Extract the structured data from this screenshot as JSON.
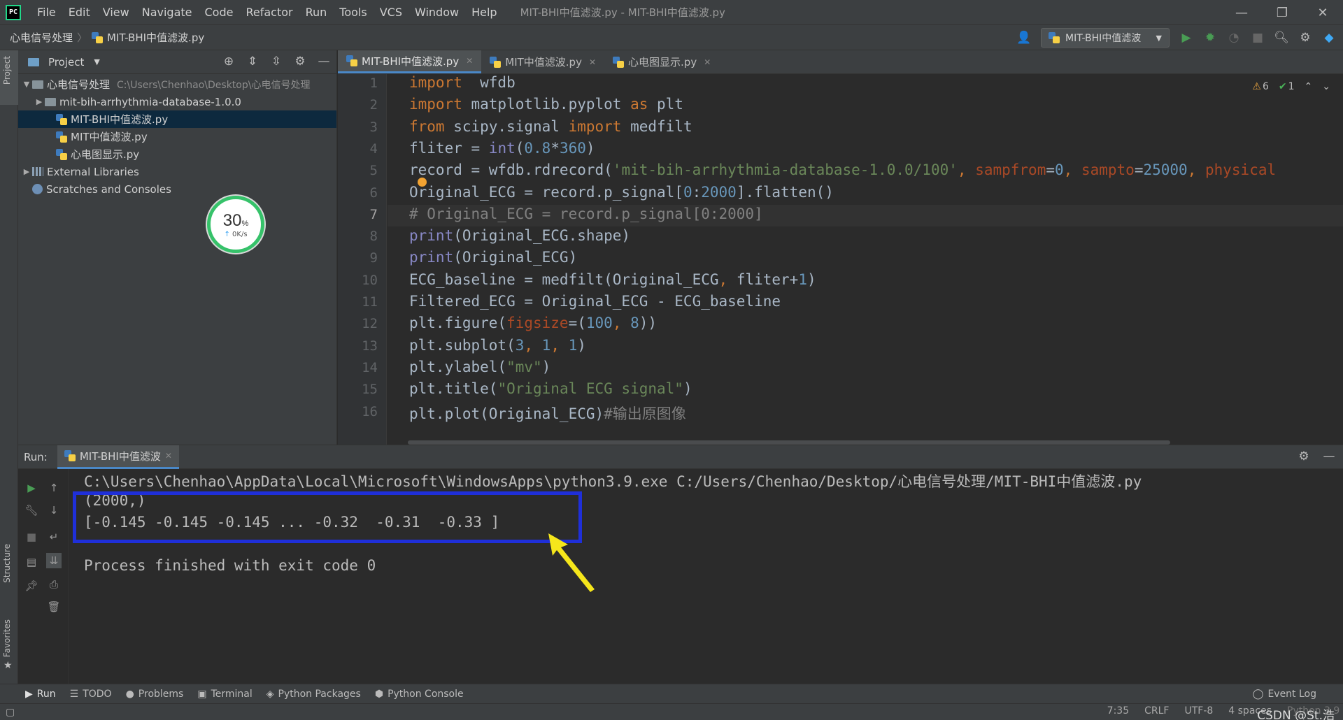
{
  "menu": {
    "items": [
      "File",
      "Edit",
      "View",
      "Navigate",
      "Code",
      "Refactor",
      "Run",
      "Tools",
      "VCS",
      "Window",
      "Help"
    ],
    "window_title": "MIT-BHI中值滤波.py - MIT-BHI中值滤波.py",
    "logo_text": "PC",
    "minimize": "—",
    "restore": "❐",
    "close": "✕"
  },
  "navbar": {
    "project": "心电信号处理",
    "separator": "〉",
    "file": "MIT-BHI中值滤波.py",
    "run_config": "MIT-BHI中值滤波"
  },
  "left_strip": {
    "project": "Project",
    "structure": "Structure",
    "favorites": "Favorites"
  },
  "project_panel": {
    "title": "Project",
    "tree": {
      "root": "心电信号处理",
      "root_path": "C:\\Users\\Chenhao\\Desktop\\心电信号处理",
      "db_folder": "mit-bih-arrhythmia-database-1.0.0",
      "files": [
        "MIT-BHI中值滤波.py",
        "MIT中值滤波.py",
        "心电图显示.py"
      ],
      "external": "External Libraries",
      "scratches": "Scratches and Consoles"
    }
  },
  "speed_widget": {
    "percent": "30",
    "unit": "%",
    "rate": "0K/s"
  },
  "editor": {
    "tabs": [
      "MIT-BHI中值滤波.py",
      "MIT中值滤波.py",
      "心电图显示.py"
    ],
    "active_tab": 0,
    "current_line": 7,
    "inspections": {
      "warnings": "6",
      "weak": "1"
    },
    "line_numbers": [
      "1",
      "2",
      "3",
      "4",
      "5",
      "6",
      "7",
      "8",
      "9",
      "10",
      "11",
      "12",
      "13",
      "14",
      "15",
      "16"
    ],
    "code": [
      [
        [
          "kw",
          "import"
        ],
        [
          "",
          "  wfdb"
        ]
      ],
      [
        [
          "kw",
          "import"
        ],
        [
          "",
          " matplotlib.pyplot "
        ],
        [
          "kw",
          "as"
        ],
        [
          "",
          " plt"
        ]
      ],
      [
        [
          "kw",
          "from"
        ],
        [
          "",
          " scipy.signal "
        ],
        [
          "kw",
          "import"
        ],
        [
          "",
          " medfilt"
        ]
      ],
      [
        [
          "",
          "fliter = "
        ],
        [
          "bi",
          "int"
        ],
        [
          "",
          "("
        ],
        [
          "num",
          "0.8"
        ],
        [
          "",
          "*"
        ],
        [
          "num",
          "360"
        ],
        [
          "",
          ")"
        ]
      ],
      [
        [
          "",
          "record = wfdb.rdrecord("
        ],
        [
          "str",
          "'mit-bih-arrhythmia-database-1.0.0/100'"
        ],
        [
          "kw",
          ", "
        ],
        [
          "param",
          "sampfrom"
        ],
        [
          "",
          "="
        ],
        [
          "num",
          "0"
        ],
        [
          "kw",
          ", "
        ],
        [
          "param",
          "sampto"
        ],
        [
          "",
          "="
        ],
        [
          "num",
          "25000"
        ],
        [
          "kw",
          ", "
        ],
        [
          "param",
          "physical"
        ]
      ],
      [
        [
          "",
          "Original_ECG = record.p_signal["
        ],
        [
          "num",
          "0"
        ],
        [
          "",
          ":"
        ],
        [
          "num",
          "2000"
        ],
        [
          "",
          "].flatten()"
        ]
      ],
      [
        [
          "cmt",
          "# Original_ECG = record.p_signal[0:2000]"
        ]
      ],
      [
        [
          "bi",
          "print"
        ],
        [
          "",
          "(Original_ECG.shape)"
        ]
      ],
      [
        [
          "bi",
          "print"
        ],
        [
          "",
          "(Original_ECG)"
        ]
      ],
      [
        [
          "",
          "ECG_baseline = medfilt(Original_ECG"
        ],
        [
          "kw",
          ", "
        ],
        [
          "",
          "fliter+"
        ],
        [
          "num",
          "1"
        ],
        [
          "",
          ")"
        ]
      ],
      [
        [
          "",
          "Filtered_ECG = Original_ECG - ECG_baseline"
        ]
      ],
      [
        [
          "",
          "plt.figure("
        ],
        [
          "param",
          "figsize"
        ],
        [
          "",
          "=("
        ],
        [
          "num",
          "100"
        ],
        [
          "kw",
          ", "
        ],
        [
          "num",
          "8"
        ],
        [
          "",
          "))"
        ]
      ],
      [
        [
          "",
          "plt.subplot("
        ],
        [
          "num",
          "3"
        ],
        [
          "kw",
          ", "
        ],
        [
          "num",
          "1"
        ],
        [
          "kw",
          ", "
        ],
        [
          "num",
          "1"
        ],
        [
          "",
          ")"
        ]
      ],
      [
        [
          "",
          "plt.ylabel("
        ],
        [
          "str",
          "\"mv\""
        ],
        [
          "",
          ")"
        ]
      ],
      [
        [
          "",
          "plt.title("
        ],
        [
          "str",
          "\"Original ECG signal\""
        ],
        [
          "",
          ")"
        ]
      ],
      [
        [
          "",
          "plt.plot(Original_ECG)"
        ],
        [
          "cmt",
          "#输出原图像"
        ]
      ]
    ]
  },
  "run_panel": {
    "label": "Run:",
    "tab": "MIT-BHI中值滤波",
    "console": [
      "C:\\Users\\Chenhao\\AppData\\Local\\Microsoft\\WindowsApps\\python3.9.exe C:/Users/Chenhao/Desktop/心电信号处理/MIT-BHI中值滤波.py",
      "(2000,)",
      "[-0.145 -0.145 -0.145 ... -0.32  -0.31  -0.33 ]",
      "",
      "Process finished with exit code 0"
    ]
  },
  "bottom_tools": {
    "items": [
      "Run",
      "TODO",
      "Problems",
      "Terminal",
      "Python Packages",
      "Python Console"
    ],
    "event_log": "Event Log"
  },
  "statusbar": {
    "position": "7:35",
    "line_sep": "CRLF",
    "encoding": "UTF-8",
    "indent": "4 spaces",
    "interpreter": "Python 3.9",
    "watermark": "CSDN @St.浩"
  },
  "colors": {
    "accent": "#4a88c7",
    "highlight_box": "#1f2fd9",
    "arrow": "#f5e61b",
    "run_green": "#499c54"
  }
}
